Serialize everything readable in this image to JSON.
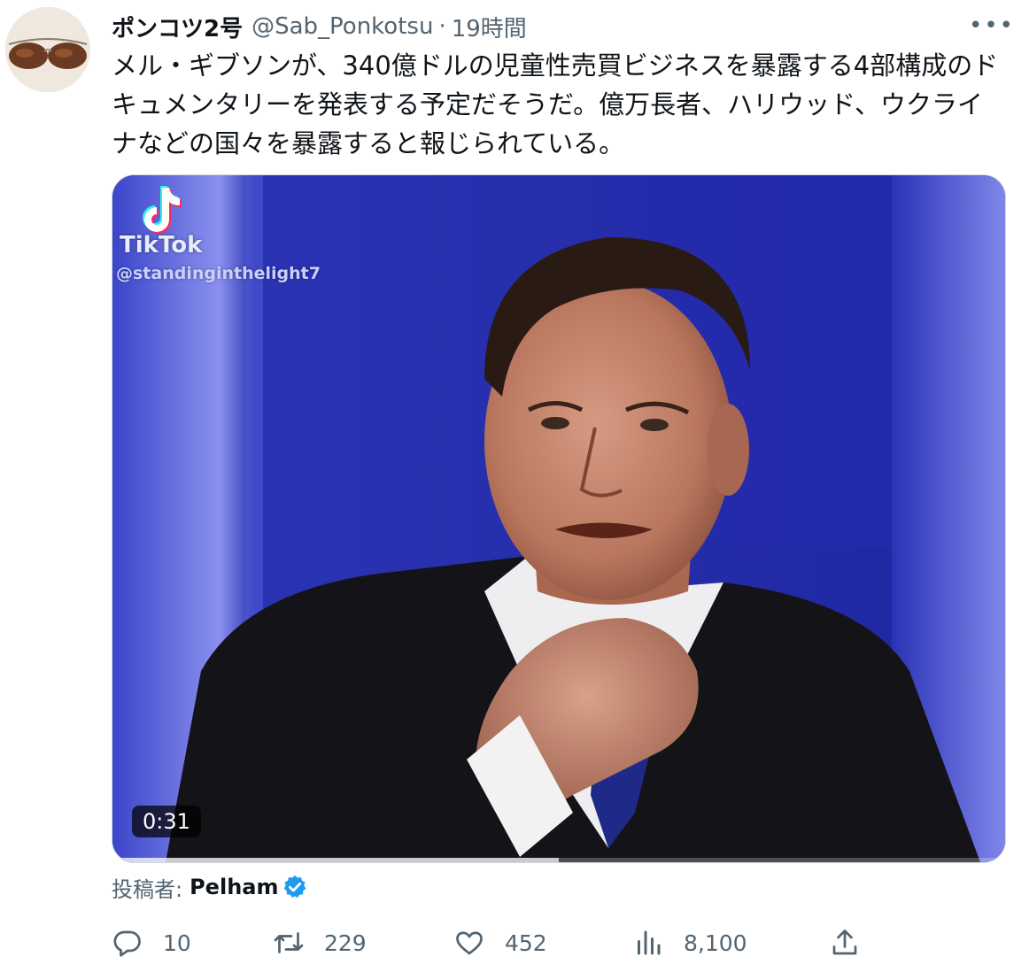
{
  "tweet": {
    "display_name": "ポンコツ2号",
    "handle": "@Sab_Ponkotsu",
    "separator": "·",
    "time": "19時間",
    "more_label": "•••",
    "text": "メル・ギブソンが、340億ドルの児童性売買ビジネスを暴露する4部構成のドキュメンタリーを発表する予定だそうだ。億万長者、ハリウッド、ウクライナなどの国々を暴露すると報じられている。"
  },
  "media": {
    "watermark_brand": "TikTok",
    "watermark_user": "@standinginthelight7",
    "duration": "0:31",
    "progress": 0.5,
    "colors": {
      "backdrop": "#2b34b8",
      "suit": "#111114"
    }
  },
  "attribution": {
    "label": "投稿者:",
    "name": "Pelham",
    "badge_color": "#1d9bf0"
  },
  "actions": {
    "reply_count": "10",
    "retweet_count": "229",
    "like_count": "452",
    "views_count": "8,100",
    "icons": [
      "reply-icon",
      "retweet-icon",
      "like-icon",
      "views-icon",
      "share-icon"
    ]
  }
}
